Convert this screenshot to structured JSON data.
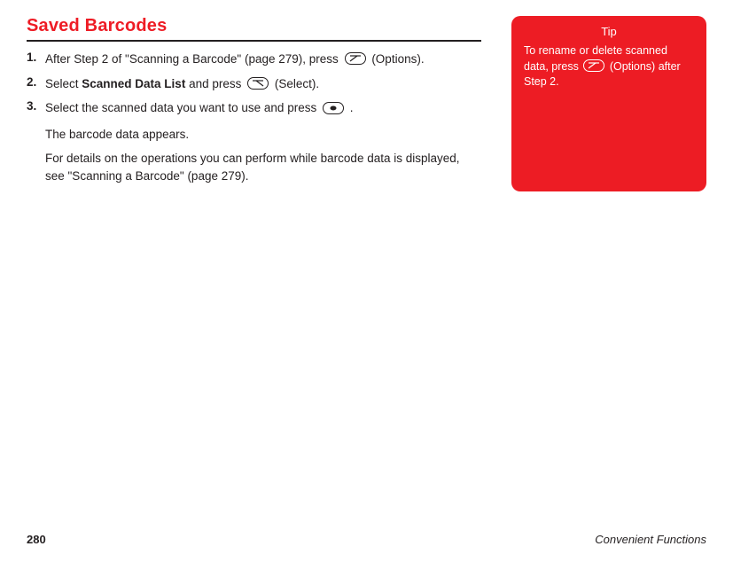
{
  "heading": "Saved Barcodes",
  "steps": [
    {
      "num": "1.",
      "pre": "After Step 2 of \"Scanning a Barcode\" (page 279), press ",
      "key": "softkey-left",
      "post": " (Options)."
    },
    {
      "num": "2.",
      "pre": "Select ",
      "bold": "Scanned Data List",
      "mid": " and press ",
      "key": "softkey-right",
      "post": " (Select)."
    },
    {
      "num": "3.",
      "pre": "Select the scanned data you want to use and press ",
      "key": "center-key",
      "post": "."
    }
  ],
  "result": {
    "line1": "The barcode data appears.",
    "line2": "For details on the operations you can perform while barcode data is displayed, see \"Scanning a Barcode\" (page 279)."
  },
  "tip": {
    "title": "Tip",
    "pre": "To rename or delete scanned data, press ",
    "post": " (Options) after Step 2."
  },
  "footer": {
    "page": "280",
    "section": "Convenient Functions"
  }
}
